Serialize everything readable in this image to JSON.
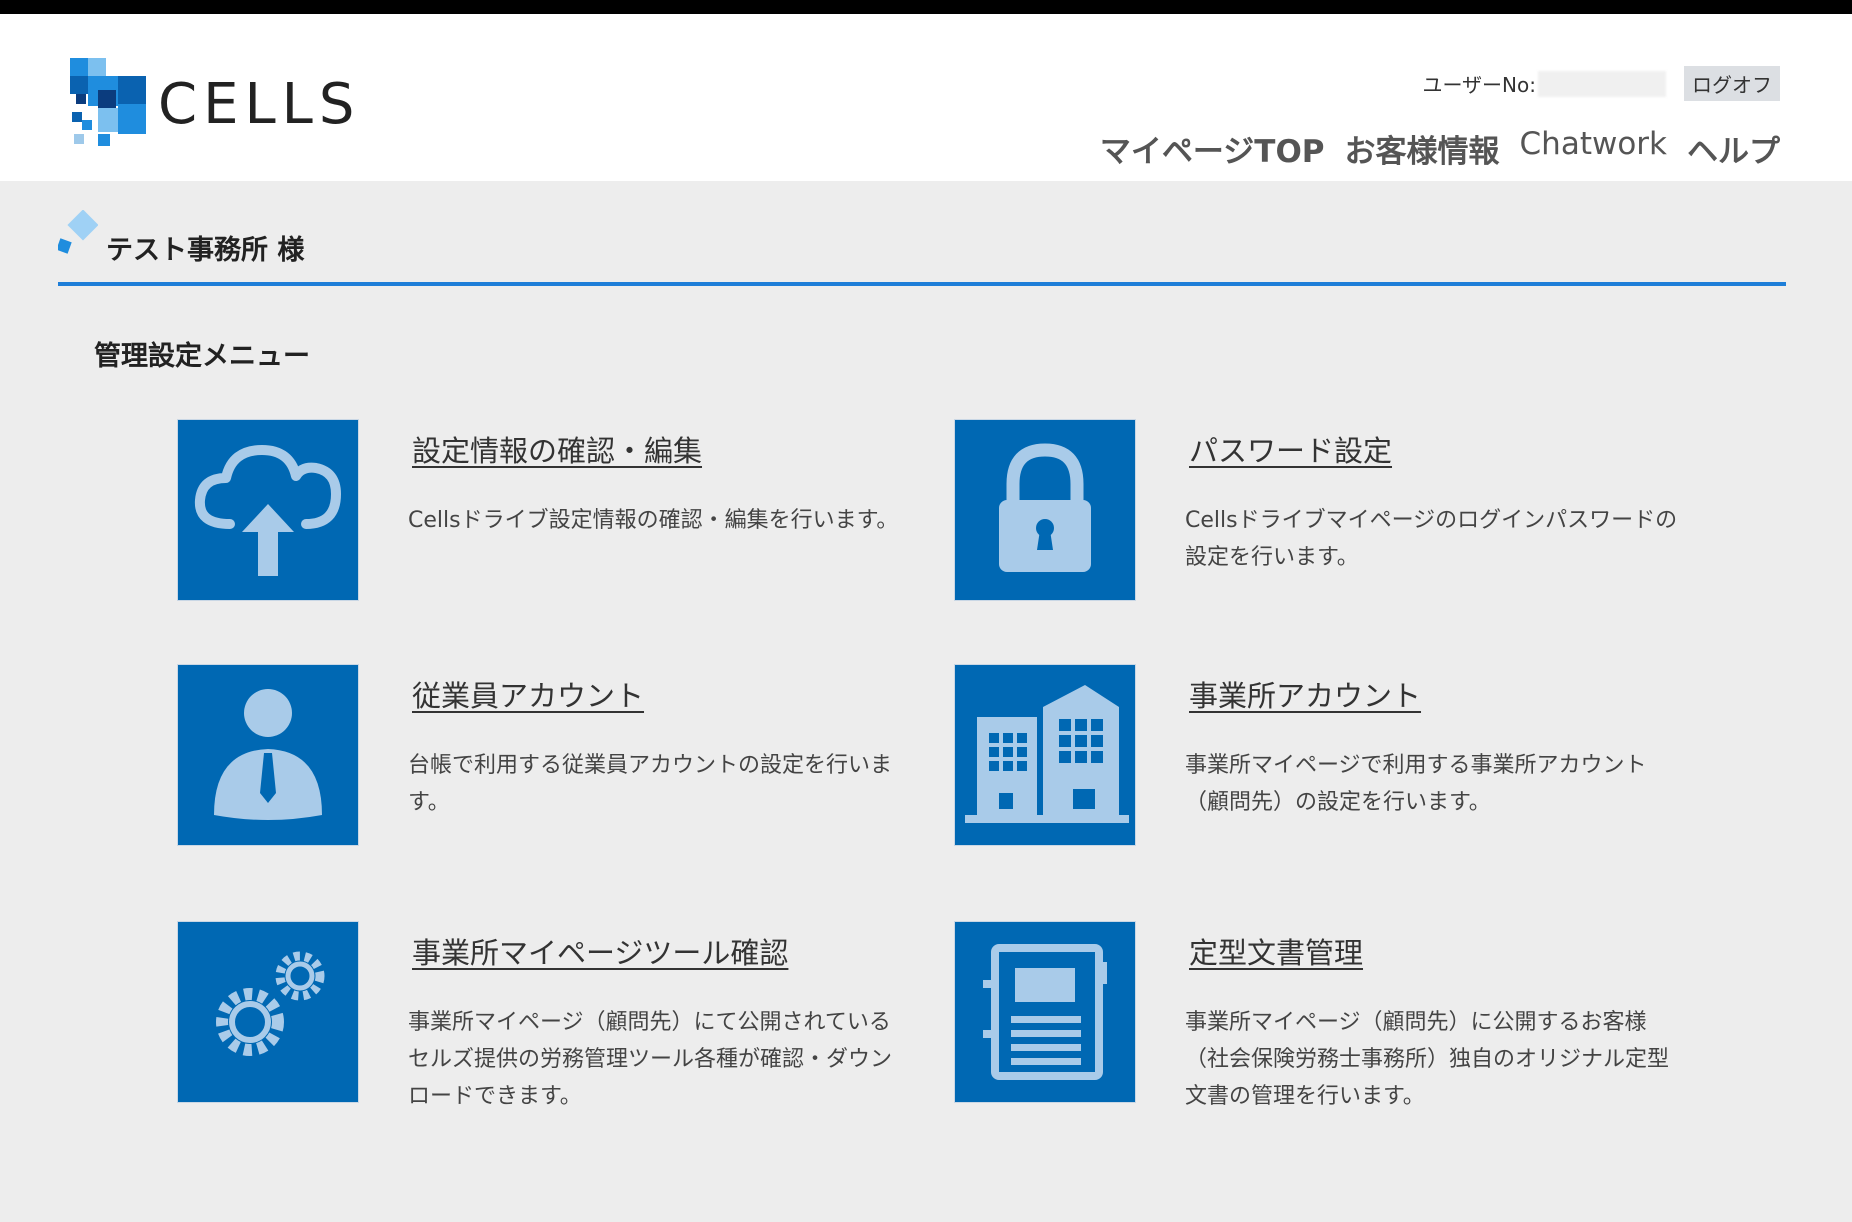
{
  "header": {
    "logo_text": "CELLS",
    "user_label": "ユーザーNo:",
    "logoff_label": "ログオフ",
    "nav": [
      "マイページTOP",
      "お客様情報",
      "Chatwork",
      "ヘルプ"
    ]
  },
  "office": {
    "name": "テスト事務所 様"
  },
  "menu": {
    "title": "管理設定メニュー",
    "items": [
      {
        "icon": "cloud-upload-icon",
        "title": "設定情報の確認・編集",
        "desc": "Cellsドライブ設定情報の確認・編集を行います。"
      },
      {
        "icon": "lock-icon",
        "title": "パスワード設定",
        "desc": "Cellsドライブマイページのログインパスワードの設定を行います。"
      },
      {
        "icon": "user-icon",
        "title": "従業員アカウント",
        "desc": "台帳で利用する従業員アカウントの設定を行います。"
      },
      {
        "icon": "building-icon",
        "title": "事業所アカウント",
        "desc": "事業所マイページで利用する事業所アカウント（顧問先）の設定を行います。"
      },
      {
        "icon": "gears-icon",
        "title": "事業所マイページツール確認",
        "desc": "事業所マイページ（顧問先）にて公開されているセルズ提供の労務管理ツール各種が確認・ダウンロードできます。"
      },
      {
        "icon": "document-icon",
        "title": "定型文書管理",
        "desc": "事業所マイページ（顧問先）に公開するお客様（社会保険労務士事務所）独自のオリジナル定型文書の管理を行います。"
      }
    ]
  },
  "colors": {
    "tile": "#0068b3",
    "rule": "#1e7ed8",
    "icon": "#a9cbe9"
  }
}
